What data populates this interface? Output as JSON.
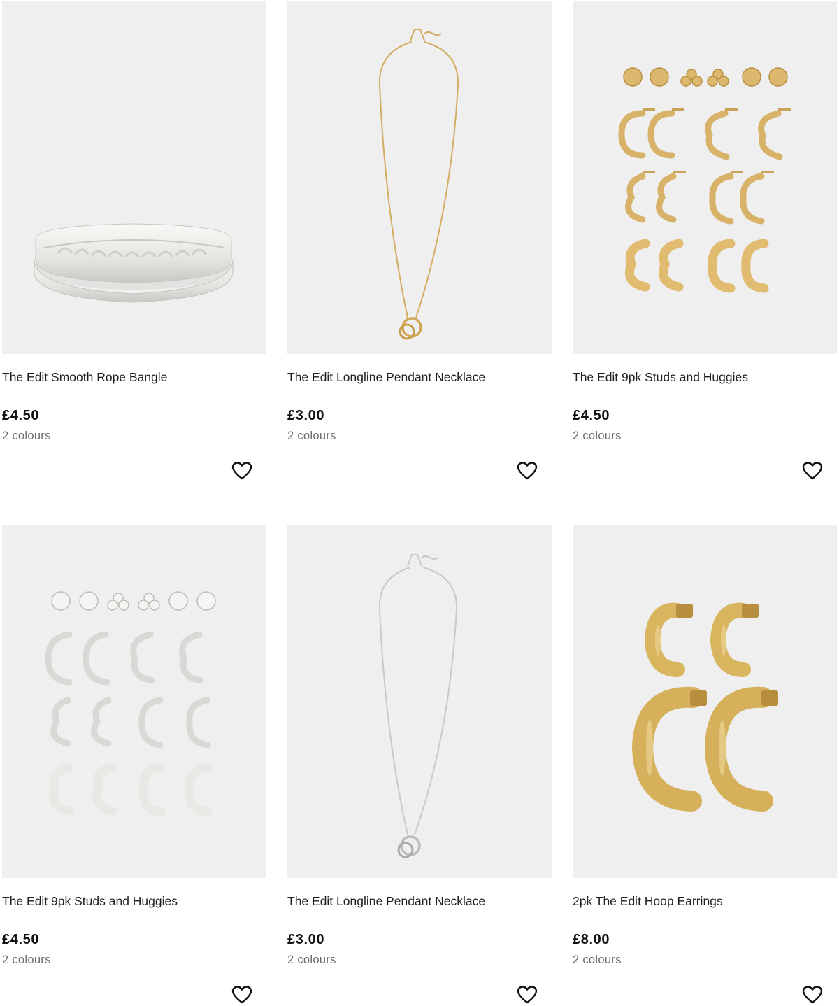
{
  "products": [
    {
      "title": "The Edit Smooth Rope Bangle",
      "price": "£4.50",
      "colours": "2 colours",
      "image_kind": "silver-bangle"
    },
    {
      "title": "The Edit Longline Pendant Necklace",
      "price": "£3.00",
      "colours": "2 colours",
      "image_kind": "gold-necklace"
    },
    {
      "title": "The Edit 9pk Studs and Huggies",
      "price": "£4.50",
      "colours": "2 colours",
      "image_kind": "gold-earring-set"
    },
    {
      "title": "The Edit 9pk Studs and Huggies",
      "price": "£4.50",
      "colours": "2 colours",
      "image_kind": "silver-earring-set"
    },
    {
      "title": "The Edit Longline Pendant Necklace",
      "price": "£3.00",
      "colours": "2 colours",
      "image_kind": "silver-necklace"
    },
    {
      "title": "2pk The Edit Hoop Earrings",
      "price": "£8.00",
      "colours": "2 colours",
      "image_kind": "gold-hoops"
    }
  ],
  "icons": {
    "wishlist": "heart-outline-icon"
  },
  "colors": {
    "image_bg": "#efefef",
    "gold": "#d9b46a",
    "silver": "#d6d6d6",
    "text": "#1f1f1f",
    "muted": "#6b6b6b"
  }
}
